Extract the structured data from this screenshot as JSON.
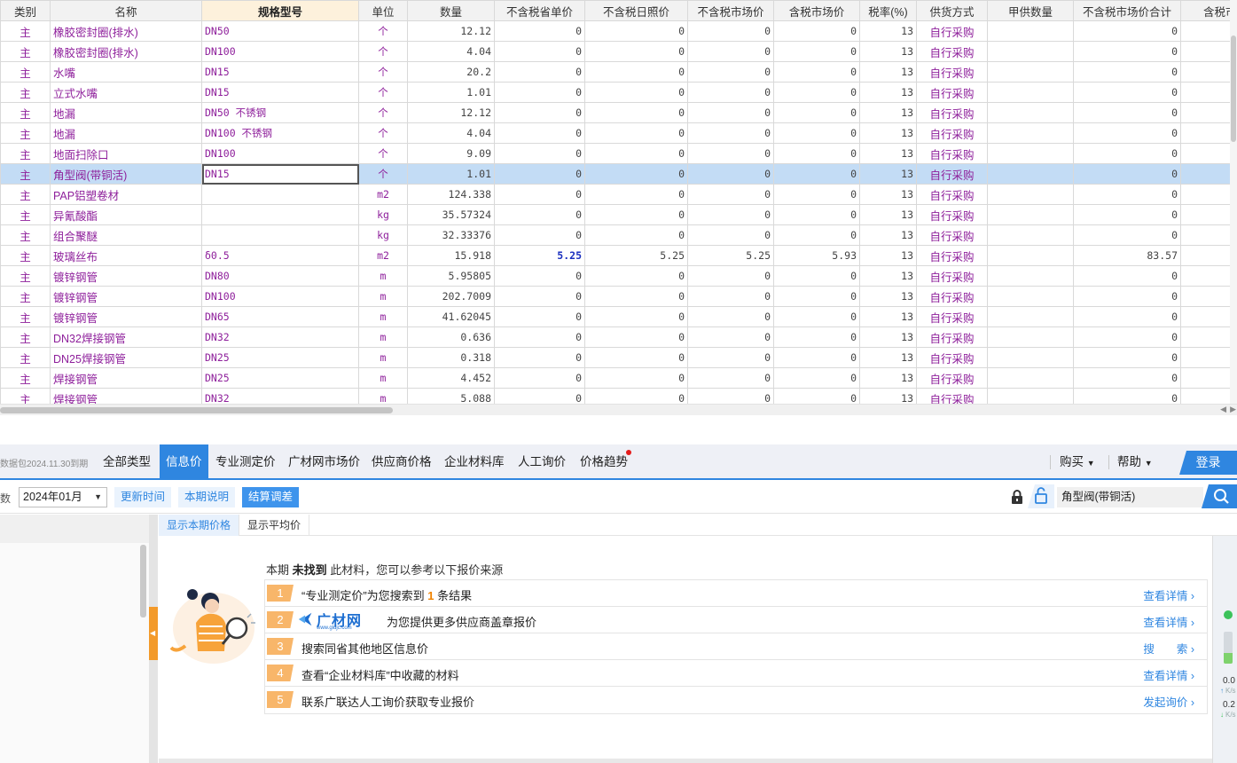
{
  "grid": {
    "columns": [
      "类别",
      "名称",
      "规格型号",
      "单位",
      "数量",
      "不含税省单价",
      "不含税日照价",
      "不含税市场价",
      "含税市场价",
      "税率(%)",
      "供货方式",
      "甲供数量",
      "不含税市场价合计",
      "含税市场"
    ],
    "rows": [
      {
        "cat": "主",
        "name": "橡胶密封圈(排水)",
        "spec": "DN50",
        "unit": "个",
        "qty": "12.12",
        "p1": "0",
        "p2": "0",
        "p3": "0",
        "p4": "0",
        "tax": "13",
        "supply": "自行采购",
        "jia": "",
        "total": "0"
      },
      {
        "cat": "主",
        "name": "橡胶密封圈(排水)",
        "spec": "DN100",
        "unit": "个",
        "qty": "4.04",
        "p1": "0",
        "p2": "0",
        "p3": "0",
        "p4": "0",
        "tax": "13",
        "supply": "自行采购",
        "jia": "",
        "total": "0"
      },
      {
        "cat": "主",
        "name": "水嘴",
        "spec": "DN15",
        "unit": "个",
        "qty": "20.2",
        "p1": "0",
        "p2": "0",
        "p3": "0",
        "p4": "0",
        "tax": "13",
        "supply": "自行采购",
        "jia": "",
        "total": "0"
      },
      {
        "cat": "主",
        "name": "立式水嘴",
        "spec": "DN15",
        "unit": "个",
        "qty": "1.01",
        "p1": "0",
        "p2": "0",
        "p3": "0",
        "p4": "0",
        "tax": "13",
        "supply": "自行采购",
        "jia": "",
        "total": "0"
      },
      {
        "cat": "主",
        "name": "地漏",
        "spec": "DN50 不锈钢",
        "unit": "个",
        "qty": "12.12",
        "p1": "0",
        "p2": "0",
        "p3": "0",
        "p4": "0",
        "tax": "13",
        "supply": "自行采购",
        "jia": "",
        "total": "0"
      },
      {
        "cat": "主",
        "name": "地漏",
        "spec": "DN100 不锈钢",
        "unit": "个",
        "qty": "4.04",
        "p1": "0",
        "p2": "0",
        "p3": "0",
        "p4": "0",
        "tax": "13",
        "supply": "自行采购",
        "jia": "",
        "total": "0"
      },
      {
        "cat": "主",
        "name": "地面扫除口",
        "spec": "DN100",
        "unit": "个",
        "qty": "9.09",
        "p1": "0",
        "p2": "0",
        "p3": "0",
        "p4": "0",
        "tax": "13",
        "supply": "自行采购",
        "jia": "",
        "total": "0"
      },
      {
        "cat": "主",
        "name": "角型阀(带铜活)",
        "spec": "DN15",
        "unit": "个",
        "qty": "1.01",
        "p1": "0",
        "p2": "0",
        "p3": "0",
        "p4": "0",
        "tax": "13",
        "supply": "自行采购",
        "jia": "",
        "total": "0",
        "selected": true
      },
      {
        "cat": "主",
        "name": "PAP铝塑卷材",
        "spec": "",
        "unit": "m2",
        "qty": "124.338",
        "p1": "0",
        "p2": "0",
        "p3": "0",
        "p4": "0",
        "tax": "13",
        "supply": "自行采购",
        "jia": "",
        "total": "0"
      },
      {
        "cat": "主",
        "name": "异氰酸酯",
        "spec": "",
        "unit": "kg",
        "qty": "35.57324",
        "p1": "0",
        "p2": "0",
        "p3": "0",
        "p4": "0",
        "tax": "13",
        "supply": "自行采购",
        "jia": "",
        "total": "0"
      },
      {
        "cat": "主",
        "name": "组合聚醚",
        "spec": "",
        "unit": "kg",
        "qty": "32.33376",
        "p1": "0",
        "p2": "0",
        "p3": "0",
        "p4": "0",
        "tax": "13",
        "supply": "自行采购",
        "jia": "",
        "total": "0"
      },
      {
        "cat": "主",
        "name": "玻璃丝布",
        "spec": "δ0.5",
        "unit": "m2",
        "qty": "15.918",
        "p1": "5.25",
        "p2": "5.25",
        "p3": "5.25",
        "p4": "5.93",
        "tax": "13",
        "supply": "自行采购",
        "jia": "",
        "total": "83.57",
        "p1bold": true
      },
      {
        "cat": "主",
        "name": "镀锌钢管",
        "spec": "DN80",
        "unit": "m",
        "qty": "5.95805",
        "p1": "0",
        "p2": "0",
        "p3": "0",
        "p4": "0",
        "tax": "13",
        "supply": "自行采购",
        "jia": "",
        "total": "0"
      },
      {
        "cat": "主",
        "name": "镀锌钢管",
        "spec": "DN100",
        "unit": "m",
        "qty": "202.7009",
        "p1": "0",
        "p2": "0",
        "p3": "0",
        "p4": "0",
        "tax": "13",
        "supply": "自行采购",
        "jia": "",
        "total": "0"
      },
      {
        "cat": "主",
        "name": "镀锌钢管",
        "spec": "DN65",
        "unit": "m",
        "qty": "41.62045",
        "p1": "0",
        "p2": "0",
        "p3": "0",
        "p4": "0",
        "tax": "13",
        "supply": "自行采购",
        "jia": "",
        "total": "0"
      },
      {
        "cat": "主",
        "name": "DN32焊接钢管",
        "spec": "DN32",
        "unit": "m",
        "qty": "0.636",
        "p1": "0",
        "p2": "0",
        "p3": "0",
        "p4": "0",
        "tax": "13",
        "supply": "自行采购",
        "jia": "",
        "total": "0"
      },
      {
        "cat": "主",
        "name": "DN25焊接钢管",
        "spec": "DN25",
        "unit": "m",
        "qty": "0.318",
        "p1": "0",
        "p2": "0",
        "p3": "0",
        "p4": "0",
        "tax": "13",
        "supply": "自行采购",
        "jia": "",
        "total": "0"
      },
      {
        "cat": "主",
        "name": "焊接钢管",
        "spec": "DN25",
        "unit": "m",
        "qty": "4.452",
        "p1": "0",
        "p2": "0",
        "p3": "0",
        "p4": "0",
        "tax": "13",
        "supply": "自行采购",
        "jia": "",
        "total": "0"
      },
      {
        "cat": "主",
        "name": "焊接钢管",
        "spec": "DN32",
        "unit": "m",
        "qty": "5.088",
        "p1": "0",
        "p2": "0",
        "p3": "0",
        "p4": "0",
        "tax": "13",
        "supply": "自行采购",
        "jia": "",
        "total": "0"
      }
    ]
  },
  "price_panel": {
    "package_label": "数据包2024.11.30到期",
    "tabs": [
      "全部类型",
      "信息价",
      "专业测定价",
      "广材网市场价",
      "供应商价格",
      "企业材料库",
      "人工询价",
      "价格趋势"
    ],
    "active_tab": "信息价",
    "buy_label": "购买",
    "help_label": "帮助",
    "login_label": "登录",
    "period_label": "期数",
    "period_value": "2024年01月",
    "update_time_label": "更新时间",
    "period_desc_label": "本期说明",
    "settle_label": "结算调差",
    "search_value": "角型阀(带铜活)",
    "subtabs": [
      "显示本期价格",
      "显示平均价"
    ],
    "intro_prefix": "本期",
    "intro_bold": "未找到",
    "intro_suffix": "此材料，您可以参考以下报价来源",
    "items": [
      {
        "no": "1",
        "pre": "“专业测定价”为您搜索到",
        "count": "1",
        "post": "条结果",
        "link": "查看详情"
      },
      {
        "no": "2",
        "logo": "广材网",
        "logo_url": "www.gldjc.com",
        "text": "为您提供更多供应商盖章报价",
        "link": "查看详情"
      },
      {
        "no": "3",
        "text": "搜索同省其他地区信息价",
        "link": "搜　　索"
      },
      {
        "no": "4",
        "text": "查看“企业材料库”中收藏的材料",
        "link": "查看详情"
      },
      {
        "no": "5",
        "text": "联系广联达人工询价获取专业报价",
        "link": "发起询价"
      }
    ],
    "speed": {
      "up": "0.0",
      "down": "0.2",
      "unit": "K/s"
    }
  },
  "colors": {
    "accent": "#2f86e0",
    "orange": "#f08300",
    "purple_text": "#8e1f9b",
    "selected_row": "#c3dcf5"
  }
}
